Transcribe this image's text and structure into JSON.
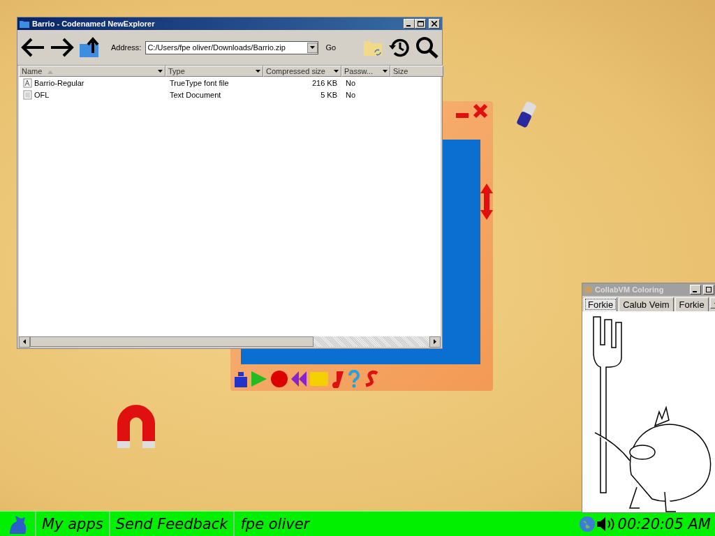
{
  "explorer": {
    "title": "Barrio - Codenamed NewExplorer",
    "address_label": "Address:",
    "address": "C:/Users/fpe oliver/Downloads/Barrio.zip",
    "go": "Go",
    "columns": [
      "Name",
      "Type",
      "Compressed size",
      "Passw...",
      "Size"
    ],
    "rows": [
      {
        "kind": "font",
        "cells": [
          "Barrio-Regular",
          "TrueType font file",
          "216 KB",
          "No"
        ]
      },
      {
        "kind": "text",
        "cells": [
          "OFL",
          "Text Document",
          "5 KB",
          "No"
        ]
      }
    ]
  },
  "coloring": {
    "title": "CollabVM Coloring",
    "tabs": [
      {
        "label": "Forkie",
        "selected": true
      },
      {
        "label": "Calub Veim",
        "selected": false
      },
      {
        "label": "Forkie",
        "selected": false
      }
    ]
  },
  "taskbar": {
    "items": [
      "My apps",
      "Send Feedback",
      "fpe oliver"
    ],
    "clock": "00:20:05 AM"
  }
}
